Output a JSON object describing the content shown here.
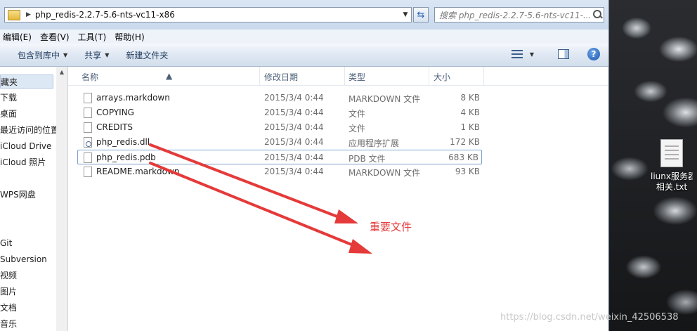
{
  "address": {
    "path": "php_redis-2.2.7-5.6-nts-vc11-x86",
    "separator": "▶"
  },
  "search": {
    "placeholder": "搜索 php_redis-2.2.7-5.6-nts-vc11-..."
  },
  "menu": [
    "编辑(E)",
    "查看(V)",
    "工具(T)",
    "帮助(H)"
  ],
  "toolbar": {
    "include_library": "包含到库中",
    "share": "共享",
    "new_folder": "新建文件夹"
  },
  "nav": {
    "items": [
      {
        "label": "藏夹",
        "selected": true
      },
      {
        "label": "下载"
      },
      {
        "label": "桌面"
      },
      {
        "label": "最近访问的位置"
      },
      {
        "label": "iCloud Drive"
      },
      {
        "label": "iCloud 照片"
      },
      {
        "label": "WPS网盘"
      },
      {
        "label": "Git"
      },
      {
        "label": "Subversion"
      },
      {
        "label": "视频"
      },
      {
        "label": "图片"
      },
      {
        "label": "文档"
      },
      {
        "label": "音乐"
      }
    ]
  },
  "columns": {
    "name": "名称",
    "date": "修改日期",
    "type": "类型",
    "size": "大小"
  },
  "files": [
    {
      "name": "arrays.markdown",
      "date": "2015/3/4 0:44",
      "type": "MARKDOWN 文件",
      "size": "8 KB",
      "icon": "file-icon"
    },
    {
      "name": "COPYING",
      "date": "2015/3/4 0:44",
      "type": "文件",
      "size": "4 KB",
      "icon": "file-icon"
    },
    {
      "name": "CREDITS",
      "date": "2015/3/4 0:44",
      "type": "文件",
      "size": "1 KB",
      "icon": "file-icon"
    },
    {
      "name": "php_redis.dll",
      "date": "2015/3/4 0:44",
      "type": "应用程序扩展",
      "size": "172 KB",
      "icon": "dll-file-icon"
    },
    {
      "name": "php_redis.pdb",
      "date": "2015/3/4 0:44",
      "type": "PDB 文件",
      "size": "683 KB",
      "icon": "file-icon",
      "focused": true
    },
    {
      "name": "README.markdown",
      "date": "2015/3/4 0:44",
      "type": "MARKDOWN 文件",
      "size": "93 KB",
      "icon": "file-icon"
    }
  ],
  "annotation": {
    "label": "重要文件",
    "color": "#e53a3a"
  },
  "desktop": {
    "icon_label_1": "liunx服务器",
    "icon_label_2": "相关.txt"
  },
  "watermark": "https://blog.csdn.net/weixin_42506538"
}
